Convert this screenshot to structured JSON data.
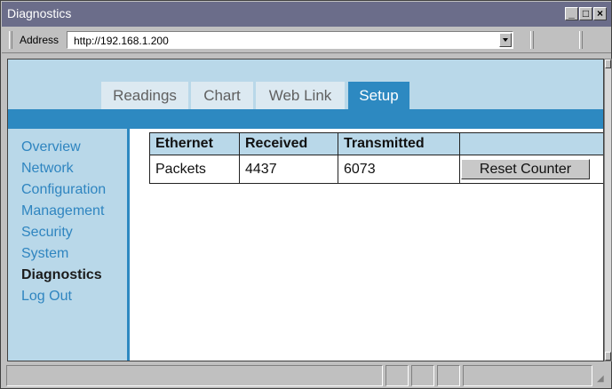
{
  "window": {
    "title": "Diagnostics"
  },
  "address": {
    "label": "Address",
    "url": "http://192.168.1.200"
  },
  "tabs": [
    {
      "label": "Readings"
    },
    {
      "label": "Chart"
    },
    {
      "label": "Web Link"
    },
    {
      "label": "Setup",
      "active": true
    }
  ],
  "sidebar": {
    "items": [
      {
        "label": "Overview"
      },
      {
        "label": "Network"
      },
      {
        "label": "Configuration"
      },
      {
        "label": "Management"
      },
      {
        "label": "Security"
      },
      {
        "label": "System"
      },
      {
        "label": "Diagnostics",
        "current": true
      },
      {
        "label": "Log Out"
      }
    ]
  },
  "table": {
    "headers": [
      "Ethernet",
      "Received",
      "Transmitted",
      ""
    ],
    "row": {
      "label": "Packets",
      "received": "4437",
      "transmitted": "6073"
    },
    "reset_label": "Reset Counter"
  },
  "colors": {
    "accent": "#2d89c1",
    "panel": "#b9d8e9",
    "titlebar": "#6b6d8a"
  },
  "icons": [
    "minimize-icon",
    "maximize-icon",
    "close-icon",
    "dropdown-arrow-icon",
    "scroll-up-icon",
    "scroll-down-icon",
    "resize-grip-icon"
  ]
}
